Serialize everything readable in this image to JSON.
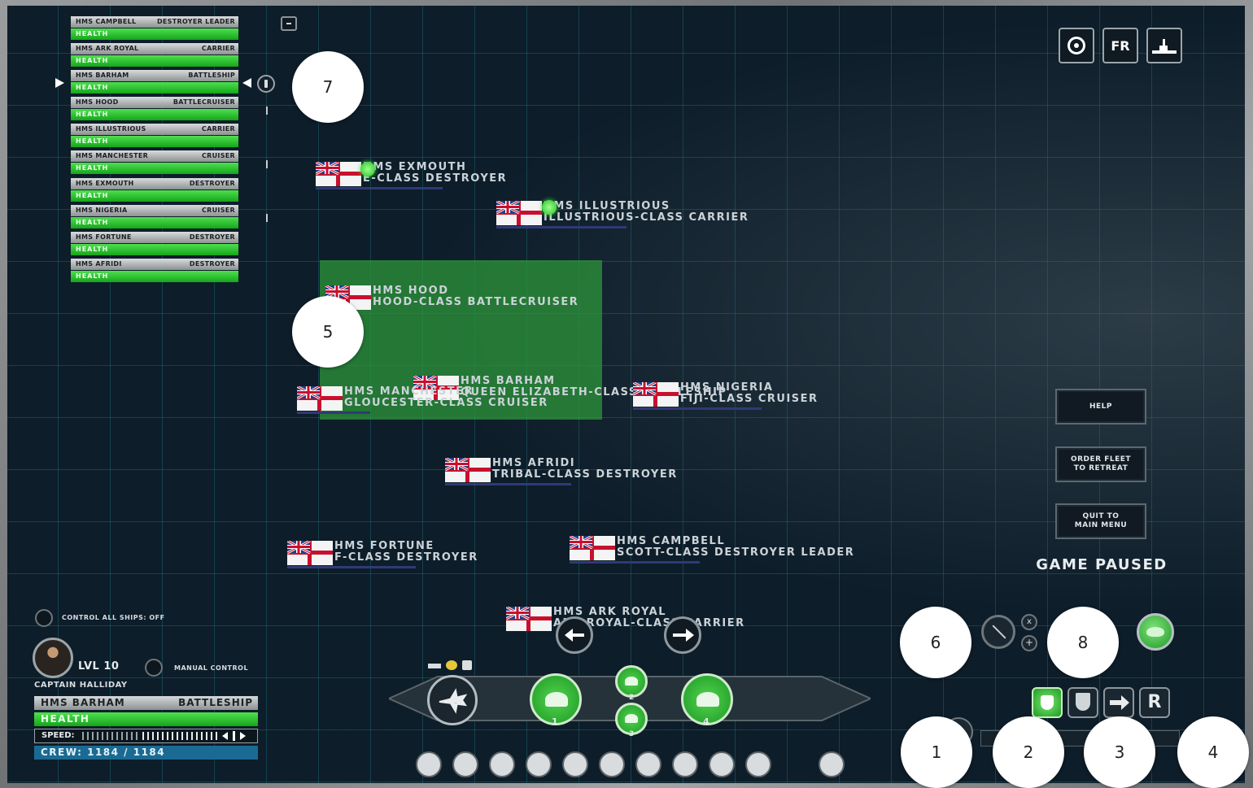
{
  "fleet_list": [
    {
      "name": "HMS CAMPBELL",
      "type": "DESTROYER LEADER",
      "health_label": "HEALTH",
      "health": 1.0
    },
    {
      "name": "HMS ARK ROYAL",
      "type": "CARRIER",
      "health_label": "HEALTH",
      "health": 1.0
    },
    {
      "name": "HMS BARHAM",
      "type": "BATTLESHIP",
      "health_label": "HEALTH",
      "health": 1.0
    },
    {
      "name": "HMS HOOD",
      "type": "BATTLECRUISER",
      "health_label": "HEALTH",
      "health": 1.0
    },
    {
      "name": "HMS ILLUSTRIOUS",
      "type": "CARRIER",
      "health_label": "HEALTH",
      "health": 1.0
    },
    {
      "name": "HMS MANCHESTER",
      "type": "CRUISER",
      "health_label": "HEALTH",
      "health": 1.0
    },
    {
      "name": "HMS EXMOUTH",
      "type": "DESTROYER",
      "health_label": "HEALTH",
      "health": 1.0
    },
    {
      "name": "HMS NIGERIA",
      "type": "CRUISER",
      "health_label": "HEALTH",
      "health": 1.0
    },
    {
      "name": "HMS FORTUNE",
      "type": "DESTROYER",
      "health_label": "HEALTH",
      "health": 1.0
    },
    {
      "name": "HMS AFRIDI",
      "type": "DESTROYER",
      "health_label": "HEALTH",
      "health": 1.0
    }
  ],
  "map_ships": [
    {
      "name": "HMS EXMOUTH",
      "class": "E-CLASS DESTROYER"
    },
    {
      "name": "HMS ILLUSTRIOUS",
      "class": "ILLUSTRIOUS-CLASS CARRIER"
    },
    {
      "name": "HMS HOOD",
      "class": "HOOD-CLASS BATTLECRUISER"
    },
    {
      "name": "HMS BARHAM",
      "class": "QUEEN ELIZABETH-CLASS BATTLESHIP"
    },
    {
      "name": "HMS MANCHESTER",
      "class": "GLOUCESTER-CLASS CRUISER"
    },
    {
      "name": "HMS NIGERIA",
      "class": "FIJI-CLASS CRUISER"
    },
    {
      "name": "HMS AFRIDI",
      "class": "TRIBAL-CLASS DESTROYER"
    },
    {
      "name": "HMS FORTUNE",
      "class": "F-CLASS DESTROYER"
    },
    {
      "name": "HMS CAMPBELL",
      "class": "SCOTT-CLASS DESTROYER LEADER"
    },
    {
      "name": "HMS ARK ROYAL",
      "class": "ARK ROYAL-CLASS CARRIER"
    }
  ],
  "top_right": {
    "fr_label": "FR"
  },
  "menu": {
    "help": "HELP",
    "retreat": "ORDER FLEET\nTO RETREAT",
    "quit": "QUIT TO\nMAIN MENU",
    "status": "GAME PAUSED"
  },
  "player": {
    "control_all": "CONTROL ALL SHIPS: OFF",
    "level": "LVL 10",
    "manual_control": "MANUAL CONTROL",
    "captain": "CAPTAIN HALLIDAY",
    "ship_name": "HMS BARHAM",
    "ship_type": "BATTLESHIP",
    "health_label": "HEALTH",
    "health": 1.0,
    "speed_label": "SPEED:",
    "crew": "CREW: 1184 / 1184"
  },
  "weapons": {
    "slot1": "1",
    "slot2": "2",
    "slot3": "3",
    "slot4": "4"
  },
  "markers": [
    "1",
    "2",
    "3",
    "4",
    "5",
    "6",
    "7",
    "8"
  ],
  "colors": {
    "health_green": "#22b62a",
    "map_bg": "#0d1d29",
    "selection": "#2e9a3a"
  }
}
